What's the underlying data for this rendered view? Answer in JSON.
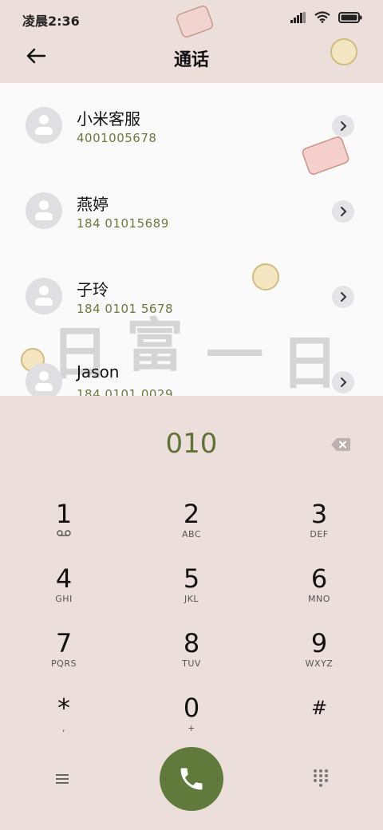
{
  "status": {
    "time": "凌晨2:36"
  },
  "header": {
    "title": "通话"
  },
  "contacts": [
    {
      "name": "小米客服",
      "number": "4001005678"
    },
    {
      "name": "燕婷",
      "number": "184 01015689"
    },
    {
      "name": "子玲",
      "number": "184 0101 5678"
    },
    {
      "name": "Jason",
      "number": "184 0101 0029"
    }
  ],
  "watermark": {
    "chars": [
      "日",
      "富",
      "一",
      "日"
    ]
  },
  "dialer": {
    "entry": "010",
    "keys": [
      {
        "digit": "1",
        "letters": ""
      },
      {
        "digit": "2",
        "letters": "ABC"
      },
      {
        "digit": "3",
        "letters": "DEF"
      },
      {
        "digit": "4",
        "letters": "GHI"
      },
      {
        "digit": "5",
        "letters": "JKL"
      },
      {
        "digit": "6",
        "letters": "MNO"
      },
      {
        "digit": "7",
        "letters": "PQRS"
      },
      {
        "digit": "8",
        "letters": "TUV"
      },
      {
        "digit": "9",
        "letters": "WXYZ"
      },
      {
        "digit": "*",
        "letters": ","
      },
      {
        "digit": "0",
        "letters": "+"
      },
      {
        "digit": "#",
        "letters": ""
      }
    ]
  },
  "colors": {
    "accent": "#5f7a3a",
    "background": "#ecdedb",
    "number": "#6b7a3c"
  },
  "icons": [
    "back-arrow-icon",
    "voicemail-icon",
    "backspace-icon",
    "menu-icon",
    "phone-icon",
    "keypad-icon",
    "chevron-right-icon"
  ]
}
